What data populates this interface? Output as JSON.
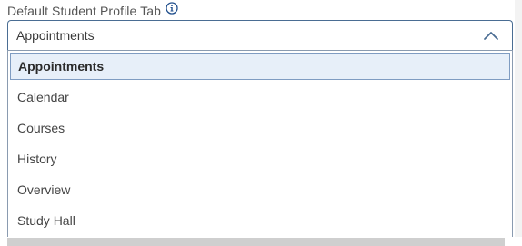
{
  "field": {
    "label": "Default Student Profile Tab",
    "info_icon": "info-circle-icon",
    "selected_value": "Appointments",
    "toggle_icon": "chevron-up-icon"
  },
  "dropdown": {
    "options": [
      {
        "label": "Appointments",
        "selected": true
      },
      {
        "label": "Calendar",
        "selected": false
      },
      {
        "label": "Courses",
        "selected": false
      },
      {
        "label": "History",
        "selected": false
      },
      {
        "label": "Overview",
        "selected": false
      },
      {
        "label": "Study Hall",
        "selected": false
      }
    ]
  },
  "colors": {
    "accent": "#4a6d93",
    "selected_bg": "#e7eff9",
    "selected_border": "#7f9cc2",
    "info_icon": "#1f4e8c"
  }
}
